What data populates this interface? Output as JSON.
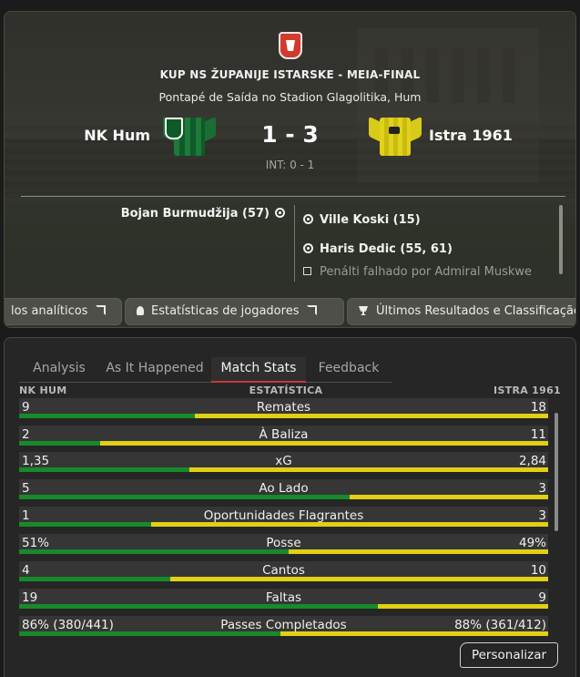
{
  "match": {
    "competition": "KUP NS ŽUPANIJE ISTARSKE - MEIA-FINAL",
    "venue": "Pontapé de Saída no Stadion Glagolitika, Hum",
    "home_team": "NK Hum",
    "away_team": "Istra 1961",
    "score": "1 - 3",
    "half_time": "INT: 0 - 1",
    "home_events": [
      "Bojan Burmudžija (57)"
    ],
    "away_events": [
      "Ville Koski (15)",
      "Haris Dedic (55, 61)"
    ],
    "away_missed": "Penálti falhado por Admiral Muskwe",
    "links": [
      "los analíticos",
      "Estatísticas de jogadores",
      "Últimos Resultados e Classificação"
    ]
  },
  "tabs": [
    "Analysis",
    "As It Happened",
    "Match Stats",
    "Feedback"
  ],
  "active_tab": "Match Stats",
  "stats_header": {
    "home": "NK HUM",
    "center": "ESTATÍSTICA",
    "away": "ISTRA 1961"
  },
  "stats": [
    {
      "label": "Remates",
      "home": "9",
      "away": "18",
      "home_share": 0.333
    },
    {
      "label": "À Baliza",
      "home": "2",
      "away": "11",
      "home_share": 0.154
    },
    {
      "label": "xG",
      "home": "1,35",
      "away": "2,84",
      "home_share": 0.322
    },
    {
      "label": "Ao Lado",
      "home": "5",
      "away": "3",
      "home_share": 0.625
    },
    {
      "label": "Oportunidades Flagrantes",
      "home": "1",
      "away": "3",
      "home_share": 0.25
    },
    {
      "label": "Posse",
      "home": "51%",
      "away": "49%",
      "home_share": 0.51
    },
    {
      "label": "Cantos",
      "home": "4",
      "away": "10",
      "home_share": 0.286
    },
    {
      "label": "Faltas",
      "home": "19",
      "away": "9",
      "home_share": 0.679
    },
    {
      "label": "Passes Completados",
      "home": "86% (380/441)",
      "away": "88% (361/412)",
      "home_share": 0.494
    }
  ],
  "customize_label": "Personalizar",
  "colors": {
    "home": "#178a2a",
    "away": "#e2d014",
    "active_tab": "#c43a3a"
  }
}
